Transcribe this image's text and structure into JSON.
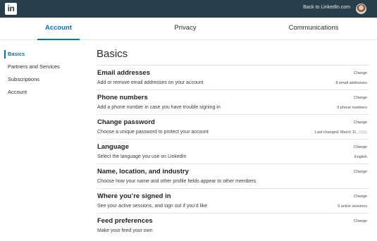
{
  "header": {
    "logo_text": "in",
    "back_link": "Back to LinkedIn.com",
    "avatar_icon": "user-avatar",
    "bar_color": "#283e4a"
  },
  "tabs": [
    {
      "label": "Account",
      "active": true
    },
    {
      "label": "Privacy",
      "active": false
    },
    {
      "label": "Communications",
      "active": false
    }
  ],
  "accent_color": "#0073b1",
  "sidebar": {
    "items": [
      {
        "label": "Basics",
        "active": true
      },
      {
        "label": "Partners and Services",
        "active": false
      },
      {
        "label": "Subscriptions",
        "active": false
      },
      {
        "label": "Account",
        "active": false
      }
    ]
  },
  "main": {
    "title": "Basics",
    "rows": [
      {
        "title": "Email addresses",
        "desc": "Add or remove email addresses on your account",
        "action": "Change",
        "value": "8 email addresses"
      },
      {
        "title": "Phone numbers",
        "desc": "Add a phone number in case you have trouble signing in",
        "action": "Change",
        "value": "0 phone numbers"
      },
      {
        "title": "Change password",
        "desc": "Choose a unique password to protect your account",
        "action": "Change",
        "value": "Last changed: March 11,"
      },
      {
        "title": "Language",
        "desc": "Select the language you use on LinkedIn",
        "action": "Change",
        "value": "English"
      },
      {
        "title": "Name, location, and industry",
        "desc": "Choose how your name and other profile fields appear to other members",
        "action": "Change",
        "value": ""
      },
      {
        "title": "Where you’re signed in",
        "desc": "See your active sessions, and sign out if you’d like",
        "action": "Change",
        "value": "5 active sessions"
      },
      {
        "title": "Feed preferences",
        "desc": "Make your feed your own",
        "action": "Change",
        "value": ""
      }
    ]
  }
}
